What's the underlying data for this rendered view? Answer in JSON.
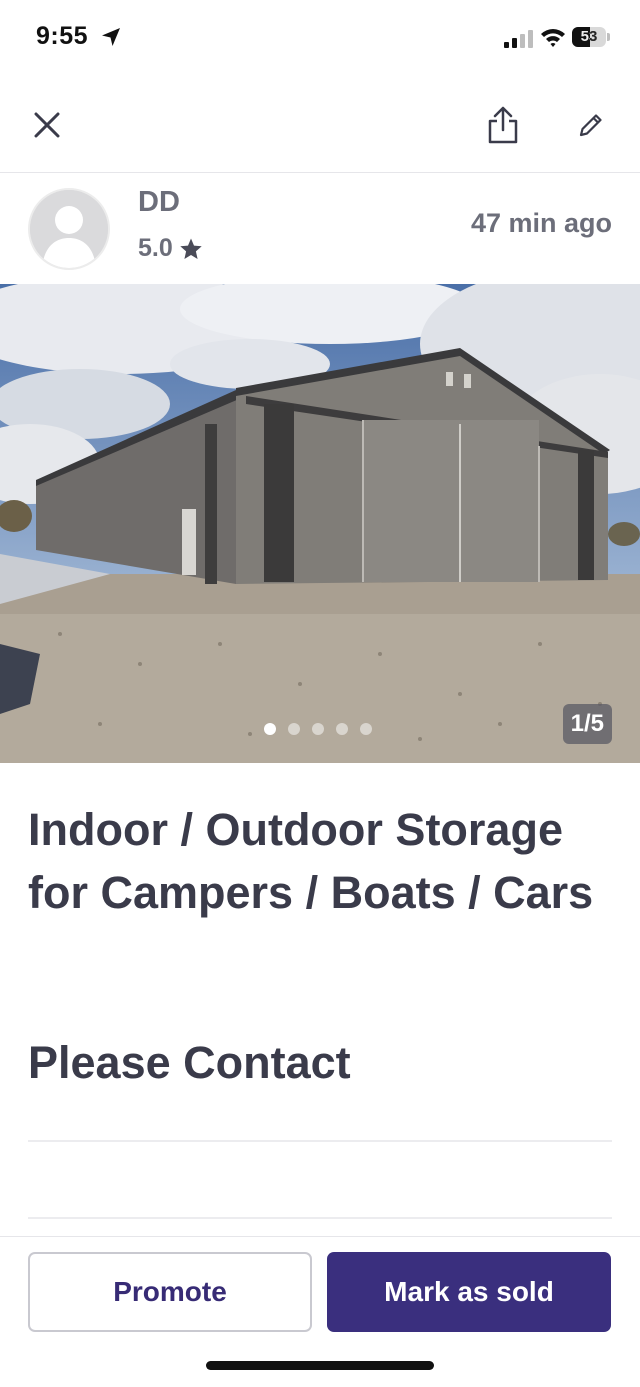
{
  "status_bar": {
    "time": "9:55",
    "battery_level": "53",
    "icons": [
      "location-arrow-icon",
      "cellular-signal-icon",
      "wifi-icon",
      "battery-icon"
    ]
  },
  "nav": {
    "icons": [
      "close-icon",
      "share-icon",
      "pencil-icon"
    ]
  },
  "seller": {
    "name": "DD",
    "rating": "5.0",
    "posted": "47 min  ago"
  },
  "photo": {
    "counter": "1/5",
    "current_index": 1,
    "total": 5
  },
  "listing": {
    "title": "Indoor / Outdoor Storage for Campers / Boats / Cars",
    "price": "Please Contact"
  },
  "actions": {
    "promote_label": "Promote",
    "mark_sold_label": "Mark as sold"
  },
  "colors": {
    "primary": "#3a2f7e",
    "text": "#3a3b4a",
    "muted": "#6c6e7a"
  }
}
